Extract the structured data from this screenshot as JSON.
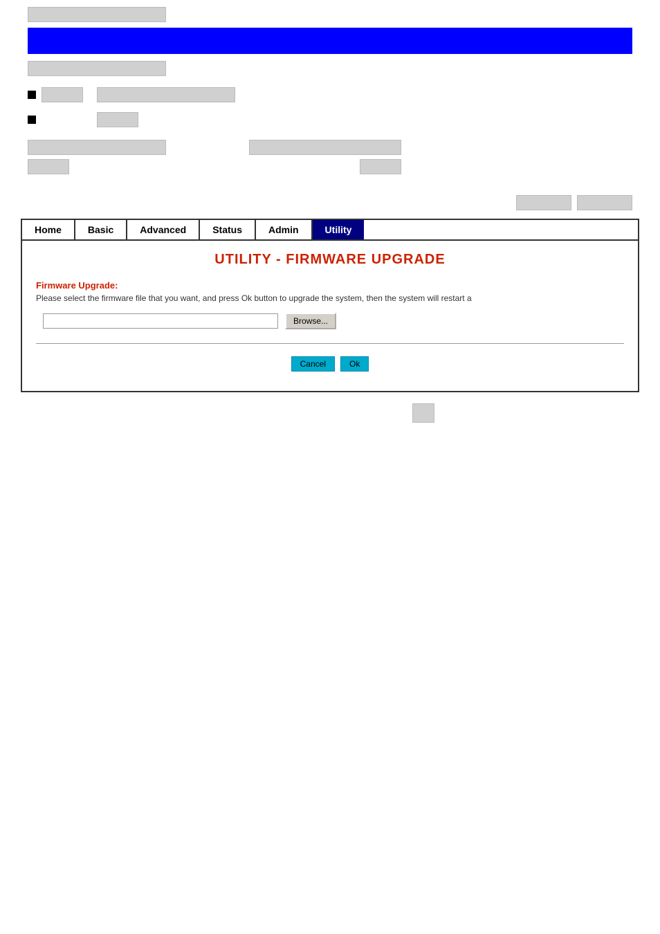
{
  "top": {
    "gray_bar_top": "",
    "blue_banner": "",
    "gray_bar_2": ""
  },
  "nav": {
    "items": [
      {
        "label": "Home",
        "id": "home"
      },
      {
        "label": "Basic",
        "id": "basic"
      },
      {
        "label": "Advanced",
        "id": "advanced"
      },
      {
        "label": "Status",
        "id": "status"
      },
      {
        "label": "Admin",
        "id": "admin"
      },
      {
        "label": "Utility",
        "id": "utility"
      }
    ]
  },
  "page": {
    "title": "UTILITY - FIRMWARE UPGRADE",
    "section_title": "Firmware Upgrade:",
    "section_desc": "Please select the firmware file that you want, and press Ok button to upgrade the system, then the system will restart a",
    "file_input_placeholder": "",
    "browse_label": "Browse...",
    "cancel_label": "Cancel",
    "ok_label": "Ok"
  }
}
